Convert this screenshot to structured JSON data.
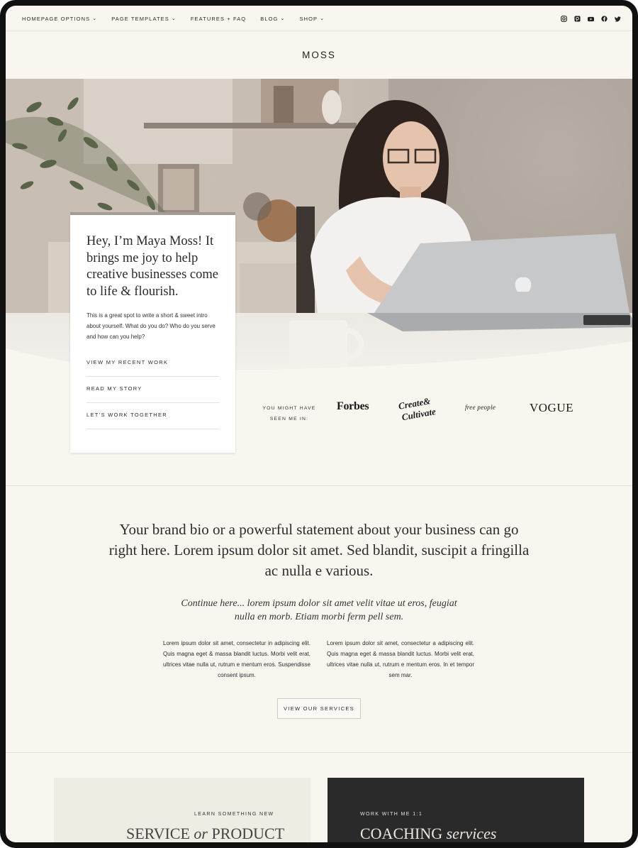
{
  "nav": {
    "items": [
      {
        "label": "HOMEPAGE OPTIONS",
        "chevron": "⌄"
      },
      {
        "label": "PAGE TEMPLATES",
        "chevron": "⌄"
      },
      {
        "label": "FEATURES + FAQ",
        "chevron": ""
      },
      {
        "label": "BLOG",
        "chevron": "⌄"
      },
      {
        "label": "SHOP",
        "chevron": "⌄"
      }
    ],
    "social_icons": [
      "instagram-icon",
      "pinterest-icon",
      "youtube-icon",
      "facebook-icon",
      "twitter-icon"
    ]
  },
  "brand": "MOSS",
  "intro": {
    "title": "Hey, I’m Maya Moss! It brings me joy to help creative businesses come to life & flourish.",
    "text": "This is a great spot to write a short & sweet intro about yourself. What do you do? Who do you serve and how can you help?",
    "links": [
      "VIEW MY RECENT WORK",
      "READ MY STORY",
      "LET’S WORK TOGETHER"
    ]
  },
  "press": {
    "label": "YOU MIGHT HAVE SEEN ME IN:",
    "logos": {
      "forbes": "Forbes",
      "create_cultivate_line1": "Create&",
      "create_cultivate_line2": "Cultivate",
      "free_people": "free people",
      "vogue": "VOGUE"
    }
  },
  "statement": {
    "main": "Your brand bio or a powerful statement about your business can go right here. Lorem ipsum dolor sit amet. Sed blandit, suscipit a fringilla ac nulla e various.",
    "italic": "Continue here... lorem ipsum dolor sit amet velit vitae ut eros, feugiat nulla en morb. Etiam morbi ferm pell sem.",
    "col_left": "Lorem ipsum dolor sit amet, consectetur in adipiscing elit. Quis magna eget & massa blandit luctus. Morbi velit erat, ultrices vitae nulla ut, rutrum e mentum eros. Suspendisse consent ipsum.",
    "col_right": "Lorem ipsum dolor sit amet, consectetur a adipiscing elit. Quis magna eget & massa blandit luctus. Morbi velit erat, ultrices vitae nulla ut, rutrum e mentum eros. In et tempor sem mar.",
    "button": "VIEW OUR SERVICES"
  },
  "panels": {
    "left": {
      "sub": "LEARN SOMETHING NEW",
      "title_a": "SERVICE ",
      "title_or": "or",
      "title_b": " PRODUCT"
    },
    "right": {
      "sub": "WORK WITH ME 1:1",
      "title_a": "COACHING ",
      "title_b": "services"
    }
  },
  "colors": {
    "background": "#f9f6f0",
    "text": "#2a2a2a",
    "dark_panel": "#2a2a2a",
    "light_panel": "#efece3"
  }
}
